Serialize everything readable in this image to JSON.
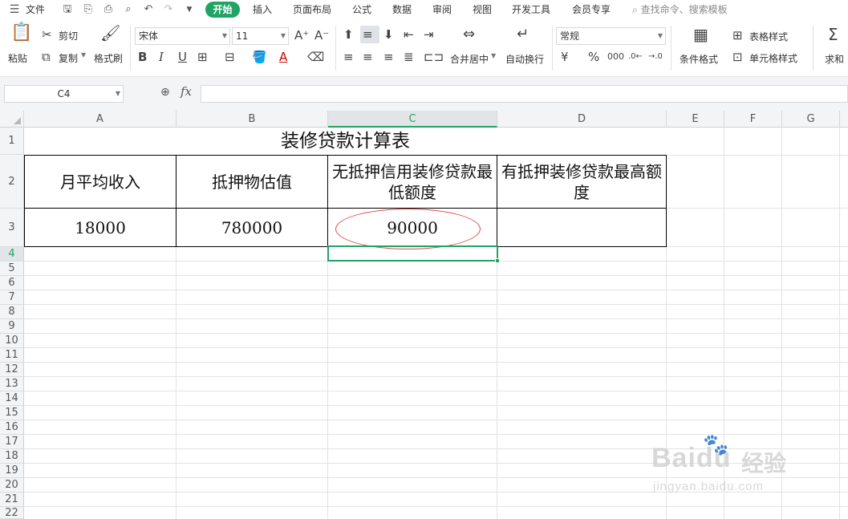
{
  "menubar": {
    "file_label": "文件",
    "tabs": [
      "开始",
      "插入",
      "页面布局",
      "公式",
      "数据",
      "审阅",
      "视图",
      "开发工具",
      "会员专享"
    ],
    "search_placeholder": "查找命令、搜索模板"
  },
  "ribbon": {
    "paste": "粘贴",
    "cut": "剪切",
    "copy": "复制",
    "format_painter": "格式刷",
    "font_name": "宋体",
    "font_size": "11",
    "bold": "B",
    "italic": "I",
    "underline": "U",
    "merge_center": "合并居中",
    "wrap_text": "自动换行",
    "number_format": "常规",
    "currency": "¥",
    "percent": "%",
    "conditional_format": "条件格式",
    "table_style": "表格样式",
    "cell_style": "单元格样式",
    "sum": "求和"
  },
  "formula_bar": {
    "cell_ref": "C4",
    "fx": "fx",
    "value": ""
  },
  "grid": {
    "columns": [
      "A",
      "B",
      "C",
      "D",
      "E",
      "F",
      "G"
    ],
    "rows": [
      "1",
      "2",
      "3",
      "4",
      "5",
      "6",
      "7",
      "8",
      "9",
      "10",
      "11",
      "12",
      "13",
      "14",
      "15",
      "16",
      "17",
      "18",
      "19",
      "20",
      "21",
      "22"
    ],
    "selected_column": "C",
    "selected_row": "4"
  },
  "sheet": {
    "title": "装修贷款计算表",
    "headers": [
      "月平均收入",
      "抵押物估值",
      "无抵押信用装修贷款最低额度",
      "有抵押装修贷款最高额度"
    ],
    "values": [
      "18000",
      "780000",
      "90000",
      ""
    ]
  },
  "watermark": {
    "brand": "Bai",
    "brand2": "du",
    "cn": "经验",
    "url": "jingyan.baidu.com"
  },
  "colors": {
    "accent": "#21a366",
    "circle": "#e04848"
  }
}
